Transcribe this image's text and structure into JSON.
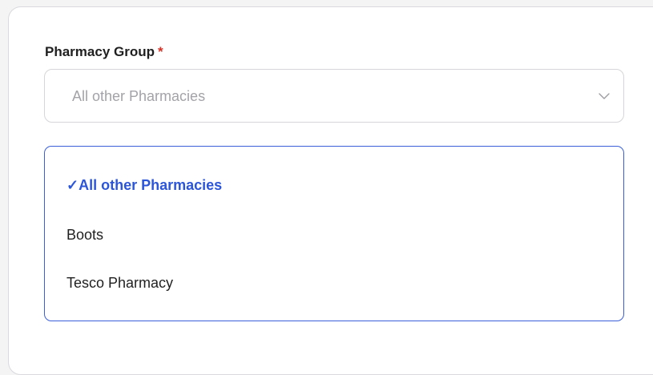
{
  "form": {
    "field_label": "Pharmacy Group",
    "required_marker": "*",
    "select": {
      "current_value": "All other Pharmacies",
      "icon": "chevron-down-icon"
    },
    "dropdown": {
      "selected_marker": "✓",
      "options": [
        {
          "label": "All other Pharmacies",
          "selected": true
        },
        {
          "label": "Boots",
          "selected": false
        },
        {
          "label": "Tesco Pharmacy",
          "selected": false
        }
      ]
    }
  },
  "colors": {
    "accent": "#2c56d9",
    "dropdown_border": "#3a5fd9",
    "required": "#d93025",
    "placeholder_text": "#a3a3a8"
  }
}
